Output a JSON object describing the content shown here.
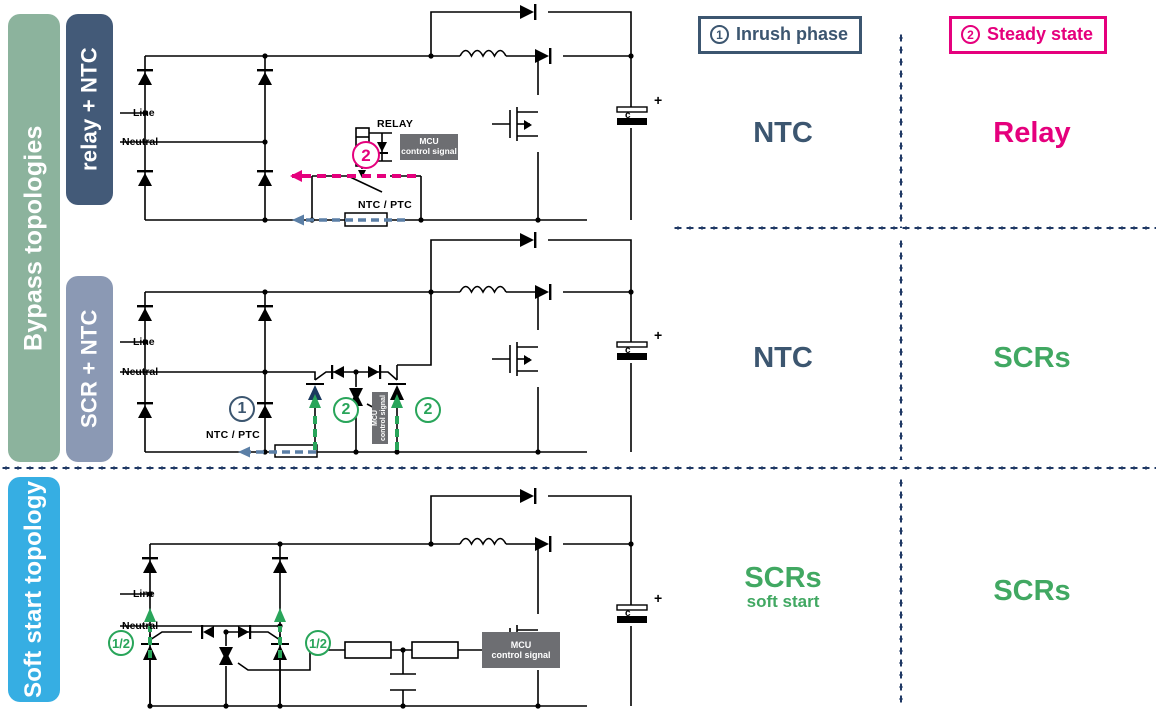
{
  "groups": {
    "bypass_label": "Bypass topologies",
    "soft_start_label": "Soft start topology",
    "relay_ntc_label": "relay + NTC",
    "scr_ntc_label": "SCR + NTC"
  },
  "header": {
    "inrush": {
      "num": "1",
      "label": "Inrush phase",
      "color": "#3c5670"
    },
    "steady": {
      "num": "2",
      "label": "Steady state",
      "color": "#e5007d"
    }
  },
  "results": {
    "row1": {
      "inrush": {
        "main": "NTC",
        "sub": "",
        "color": "#3c5670"
      },
      "steady": {
        "main": "Relay",
        "sub": "",
        "color": "#e5007d"
      }
    },
    "row2": {
      "inrush": {
        "main": "NTC",
        "sub": "",
        "color": "#3c5670"
      },
      "steady": {
        "main": "SCRs",
        "sub": "",
        "color": "#41a862"
      }
    },
    "row3": {
      "inrush": {
        "main": "SCRs",
        "sub": "soft start",
        "color": "#41a862"
      },
      "steady": {
        "main": "SCRs",
        "sub": "",
        "color": "#41a862"
      }
    }
  },
  "circuit1": {
    "line": "Line",
    "neutral": "Neutral",
    "relay": "RELAY",
    "ntc_ptc": "NTC / PTC",
    "mcu": {
      "l1": "MCU",
      "l2": "control signal"
    },
    "cap": "c",
    "cap_plus": "+",
    "marker_relay": "2"
  },
  "circuit2": {
    "line": "Line",
    "neutral": "Neutral",
    "ntc_ptc": "NTC / PTC",
    "mcu": {
      "l1": "MCU",
      "l2": "control signal"
    },
    "cap": "c",
    "cap_plus": "+",
    "marker_ntc": "1",
    "marker_scr_left": "2",
    "marker_scr_right": "2"
  },
  "circuit3": {
    "line": "Line",
    "neutral": "Neutral",
    "mcu": {
      "l1": "MCU",
      "l2": "control signal"
    },
    "cap": "c",
    "cap_plus": "+",
    "marker_left": "1/2",
    "marker_right": "1/2"
  },
  "colors": {
    "green_bar": "#8cb39d",
    "dark_blue_bar": "#435a78",
    "grey_blue_bar": "#8b99b4",
    "cyan_bar": "#36aee3",
    "pink": "#e5007d",
    "green": "#29a55a",
    "navy": "#3c5670",
    "mcu_grey": "#6d6e72"
  }
}
